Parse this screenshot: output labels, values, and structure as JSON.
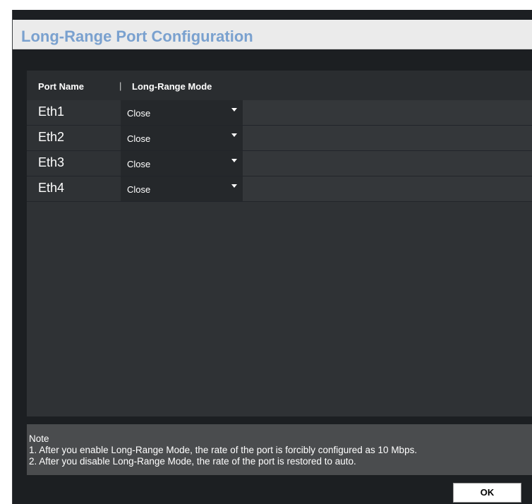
{
  "dialog": {
    "title": "Long-Range Port Configuration"
  },
  "table": {
    "headers": {
      "port_name": "Port Name",
      "separator": "|",
      "mode": "Long-Range Mode"
    },
    "rows": [
      {
        "port": "Eth1",
        "mode": "Close"
      },
      {
        "port": "Eth2",
        "mode": "Close"
      },
      {
        "port": "Eth3",
        "mode": "Close"
      },
      {
        "port": "Eth4",
        "mode": "Close"
      }
    ]
  },
  "note": {
    "heading": "Note",
    "lines": [
      "1. After you enable Long-Range Mode, the rate of the port is forcibly configured as 10 Mbps.",
      "2. After you disable Long-Range Mode, the rate of the port is restored to auto."
    ]
  },
  "buttons": {
    "ok": "OK"
  },
  "icons": {
    "dropdown": "chevron-down-icon"
  }
}
